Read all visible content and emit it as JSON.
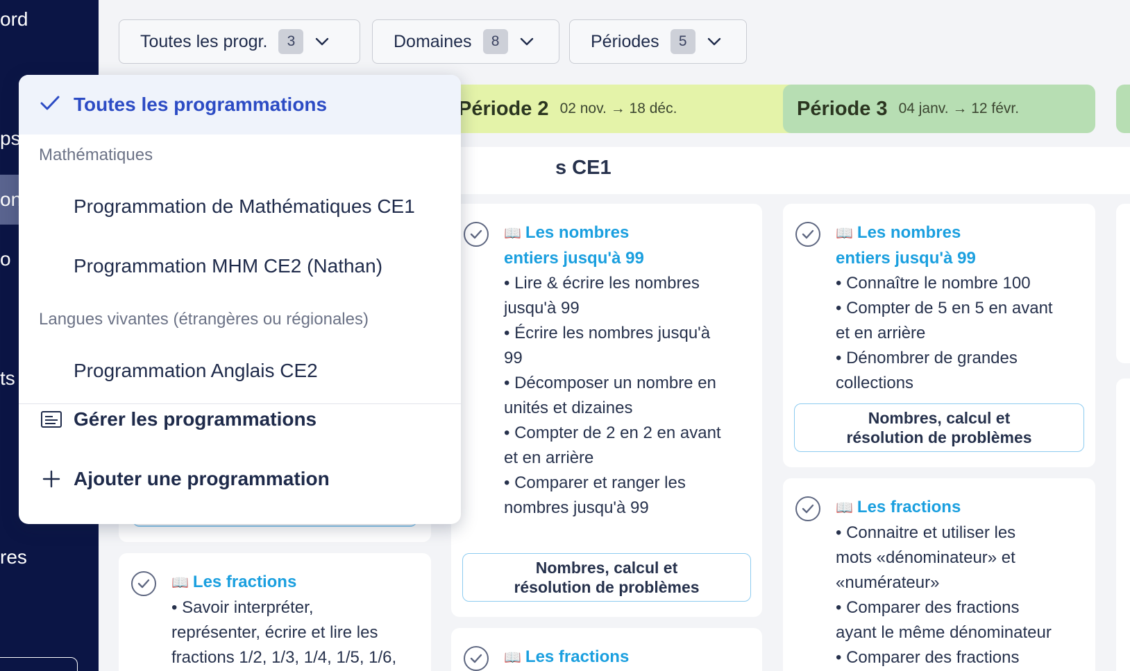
{
  "sidebar": {
    "items": [
      {
        "label": "ord",
        "active": false
      },
      {
        "label": "ps",
        "active": false
      },
      {
        "label": "on",
        "active": true
      },
      {
        "label": "o",
        "active": false
      },
      {
        "label": "ts",
        "active": false
      },
      {
        "label": "res",
        "active": false
      }
    ]
  },
  "filters": {
    "programmations": {
      "label": "Toutes les progr.",
      "count": "3"
    },
    "domaines": {
      "label": "Domaines",
      "count": "8"
    },
    "periodes": {
      "label": "Périodes",
      "count": "5"
    }
  },
  "periods": [
    {
      "name": "Période 2",
      "dates": "02 nov. → 18 déc.",
      "color": "#e4f3a9"
    },
    {
      "name": "Période 3",
      "dates": "04 janv. → 12 févr.",
      "color": "#b7deb3"
    }
  ],
  "subject_bar": {
    "title": "s CE1"
  },
  "cards": {
    "p2_nombres": {
      "title_line1": "Les nombres",
      "title_line2": "entiers jusqu'à 99",
      "bullets": [
        "• Lire & écrire les nombres",
        "jusqu'à 99",
        "• Écrire les nombres jusqu'à",
        "99",
        "• Décomposer un nombre en",
        "unités et dizaines",
        "• Compter de 2 en 2 en avant",
        "et en arrière",
        "• Comparer et ranger les",
        "nombres jusqu'à 99"
      ],
      "domain_line1": "Nombres, calcul et",
      "domain_line2": "résolution de problèmes"
    },
    "p3_nombres": {
      "title_line1": "Les nombres",
      "title_line2": "entiers jusqu'à 99",
      "bullets": [
        "• Connaître le nombre 100",
        "• Compter de 5 en 5 en avant",
        "et en arrière",
        "• Dénombrer de grandes",
        "collections"
      ],
      "domain_line1": "Nombres, calcul et",
      "domain_line2": "résolution de problèmes"
    },
    "p3_fractions": {
      "title": "Les fractions",
      "bullets": [
        "• Connaitre et utiliser les",
        "mots «dénominateur» et",
        "«numérateur»",
        "• Comparer des fractions",
        "ayant le même dénominateur",
        "• Comparer des fractions"
      ]
    },
    "p1_fractions": {
      "title": "Les fractions",
      "bullets": [
        "• Savoir interpréter,",
        "représenter, écrire et lire les",
        "fractions 1/2, 1/3, 1/4, 1/5, 1/6,"
      ]
    },
    "p2_fractions": {
      "title": "Les fractions"
    }
  },
  "dropdown": {
    "selected_label": "Toutes les programmations",
    "groups": [
      {
        "name": "Mathématiques",
        "items": [
          "Programmation de Mathématiques CE1",
          "Programmation MHM CE2 (Nathan)"
        ]
      },
      {
        "name": "Langues vivantes (étrangères ou régionales)",
        "items": [
          "Programmation Anglais CE2"
        ]
      }
    ],
    "manage_label": "Gérer les programmations",
    "add_label": "Ajouter une programmation"
  },
  "icons": {
    "book": "📖",
    "check": "check-icon",
    "chevron": "chevron-down-icon"
  }
}
